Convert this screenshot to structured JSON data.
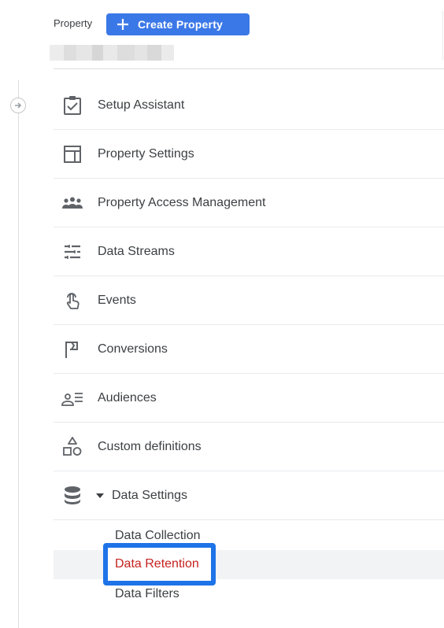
{
  "header": {
    "property_label": "Property",
    "create_button_label": "Create Property"
  },
  "nav": {
    "items": [
      {
        "label": "Setup Assistant",
        "icon": "checklist-icon"
      },
      {
        "label": "Property Settings",
        "icon": "layout-icon"
      },
      {
        "label": "Property Access Management",
        "icon": "people-icon"
      },
      {
        "label": "Data Streams",
        "icon": "streams-icon"
      },
      {
        "label": "Events",
        "icon": "touch-icon"
      },
      {
        "label": "Conversions",
        "icon": "flag-icon"
      },
      {
        "label": "Audiences",
        "icon": "audience-icon"
      },
      {
        "label": "Custom definitions",
        "icon": "shapes-icon"
      },
      {
        "label": "Data Settings",
        "icon": "database-icon"
      }
    ],
    "sub_items": [
      {
        "label": "Data Collection",
        "active": false
      },
      {
        "label": "Data Retention",
        "active": true
      },
      {
        "label": "Data Filters",
        "active": false
      }
    ]
  },
  "colors": {
    "accent": "#3b78e7",
    "highlight": "#1e73e8",
    "active_text": "#c5221f"
  }
}
